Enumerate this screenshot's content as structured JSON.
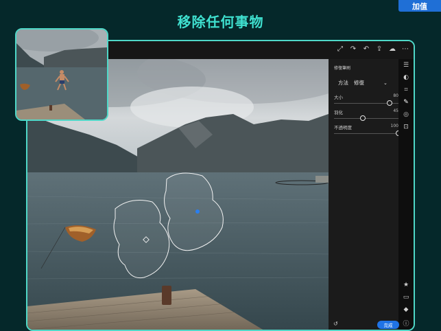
{
  "add_button": "加值",
  "headline": "移除任何事物",
  "colors": {
    "accent": "#3fe0cf",
    "frame": "#4fd8c8",
    "primary_button": "#1f73e6"
  },
  "top_toolbar": {
    "icons": [
      "crop-icon",
      "redo-icon",
      "undo-icon",
      "share-icon",
      "cloud-sync-icon",
      "more-icon"
    ]
  },
  "panel": {
    "title": "修復筆刷",
    "method_label": "方法",
    "method_value": "修復",
    "sliders": [
      {
        "label": "大小",
        "value": "80",
        "fraction": 0.86
      },
      {
        "label": "羽化",
        "value": "45",
        "fraction": 0.45
      },
      {
        "label": "不透明度",
        "value": "100",
        "fraction": 1.0
      }
    ]
  },
  "side_rail": {
    "icons": [
      "adjust-icon",
      "presets-icon",
      "crop-icon",
      "brush-icon",
      "radial-icon",
      "selective-icon",
      "star-icon",
      "comment-icon",
      "tag-icon",
      "info-icon"
    ]
  },
  "done_button": "完成"
}
